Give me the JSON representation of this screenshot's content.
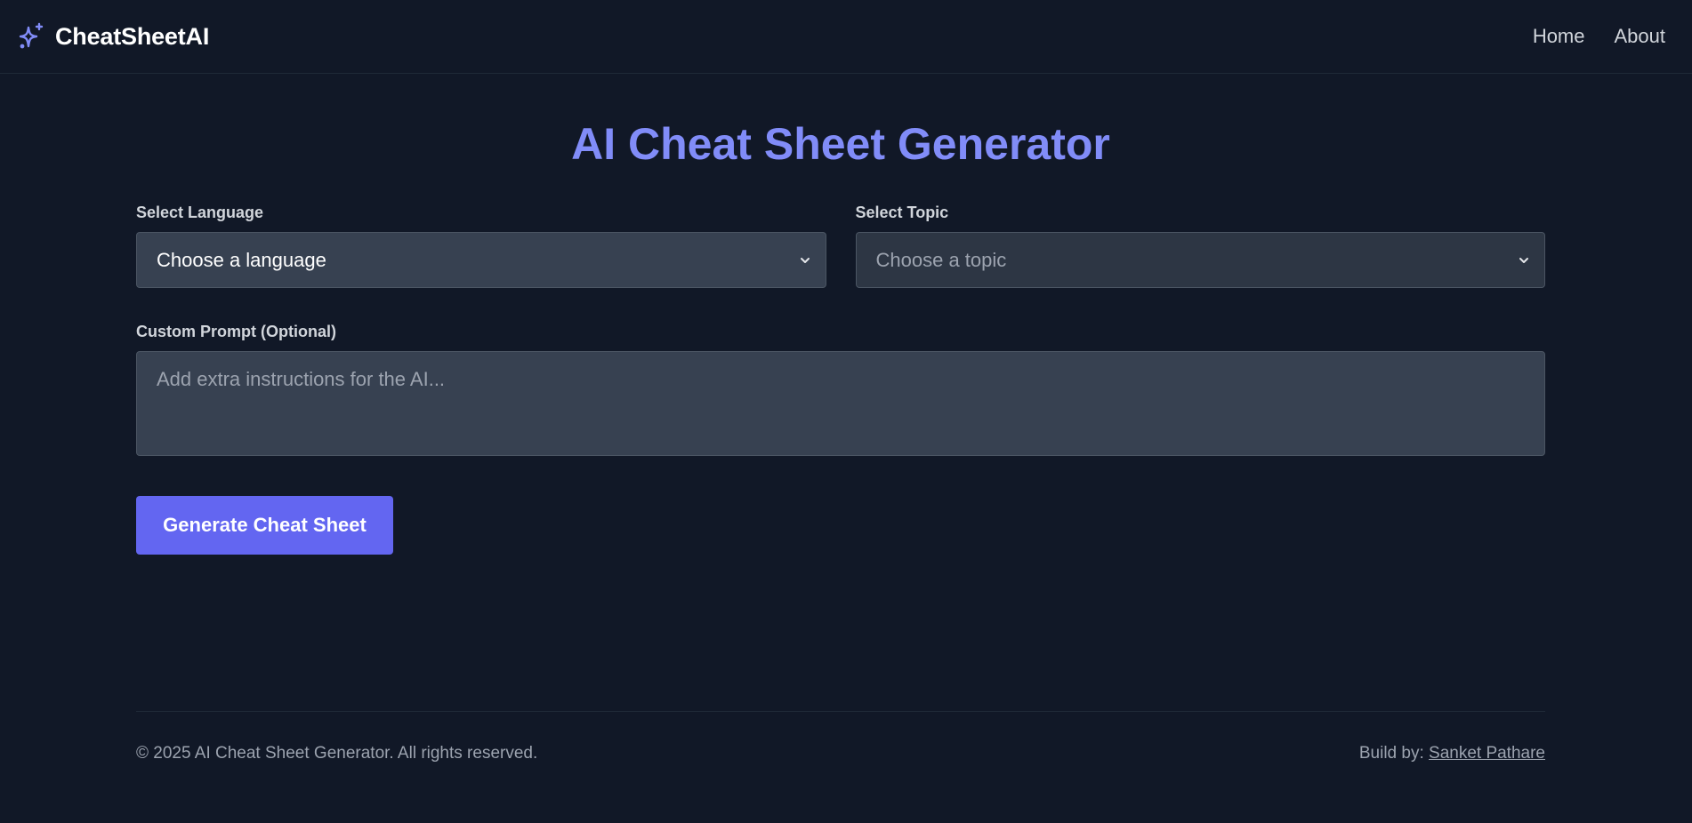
{
  "header": {
    "brand": "CheatSheetAI",
    "brand_icon": "sparkles-icon",
    "nav": [
      {
        "label": "Home"
      },
      {
        "label": "About"
      }
    ]
  },
  "main": {
    "title": "AI Cheat Sheet Generator",
    "language": {
      "label": "Select Language",
      "selected": "Choose a language"
    },
    "topic": {
      "label": "Select Topic",
      "selected": "Choose a topic"
    },
    "custom_prompt": {
      "label": "Custom Prompt (Optional)",
      "placeholder": "Add extra instructions for the AI..."
    },
    "generate_label": "Generate Cheat Sheet"
  },
  "footer": {
    "copyright": "© 2025 AI Cheat Sheet Generator. All rights reserved.",
    "credit_prefix": "Build by:",
    "credit_name": "Sanket Pathare"
  },
  "colors": {
    "background": "#111827",
    "accent": "#6366f1",
    "title": "#818cf8",
    "input_bg": "#374151"
  }
}
